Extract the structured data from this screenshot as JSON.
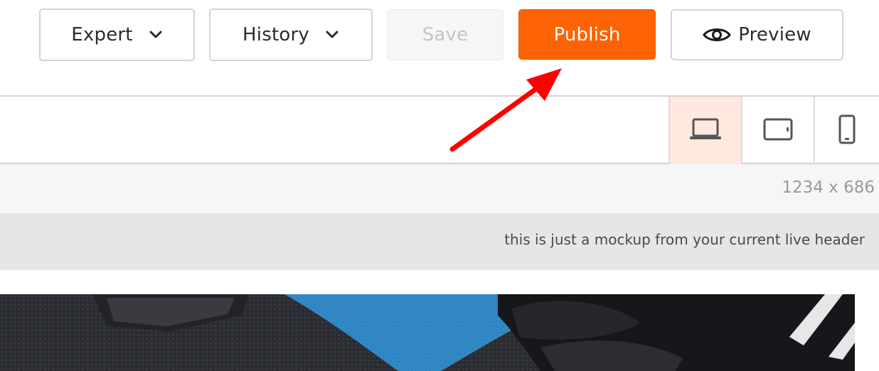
{
  "toolbar": {
    "expert_label": "Expert",
    "history_label": "History",
    "save_label": "Save",
    "publish_label": "Publish",
    "preview_label": "Preview"
  },
  "devices": [
    {
      "name": "desktop",
      "icon": "laptop-icon",
      "active": true
    },
    {
      "name": "tablet",
      "icon": "tablet-icon",
      "active": false
    },
    {
      "name": "mobile",
      "icon": "mobile-icon",
      "active": false
    }
  ],
  "viewport": {
    "dimensions_text": "1234 x 686"
  },
  "mockup": {
    "note": "this is just a mockup from your current live header"
  },
  "colors": {
    "accent": "#fd6305",
    "active_device_bg": "#ffe8dd",
    "annotation_arrow": "#ff0000"
  }
}
